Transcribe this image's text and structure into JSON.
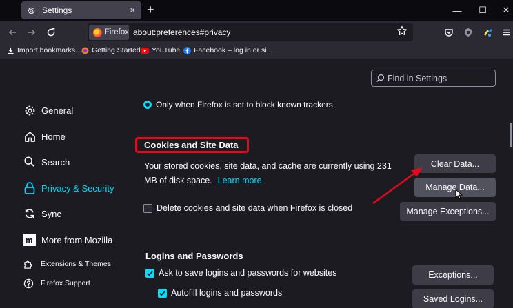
{
  "window": {
    "tab_title": "Settings",
    "tab_close": "×",
    "new_tab": "+",
    "minimize": "—",
    "maximize": "☐",
    "close": "✕"
  },
  "toolbar": {
    "identity_label": "Firefox",
    "url": "about:preferences#privacy"
  },
  "bookmarks": [
    {
      "label": "Import bookmarks...",
      "icon": "import-icon"
    },
    {
      "label": "Getting Started",
      "icon": "firefox-icon"
    },
    {
      "label": "YouTube",
      "icon": "youtube-icon"
    },
    {
      "label": "Facebook – log in or si...",
      "icon": "facebook-icon"
    }
  ],
  "search": {
    "placeholder": "Find in Settings"
  },
  "sidebar": {
    "items": [
      {
        "label": "General",
        "icon": "gear-icon"
      },
      {
        "label": "Home",
        "icon": "home-icon"
      },
      {
        "label": "Search",
        "icon": "search-icon"
      },
      {
        "label": "Privacy & Security",
        "icon": "lock-icon",
        "selected": true
      },
      {
        "label": "Sync",
        "icon": "sync-icon"
      },
      {
        "label": "More from Mozilla",
        "icon": "mozilla-icon"
      },
      {
        "label": "Extensions & Themes",
        "icon": "puzzle-icon"
      },
      {
        "label": "Firefox Support",
        "icon": "help-icon"
      }
    ]
  },
  "main": {
    "cut_option": "Only when Firefox is set to block known trackers",
    "cookies": {
      "title": "Cookies and Site Data",
      "description": "Your stored cookies, site data, and cache are currently using 231 MB of disk space.",
      "learn_more": "Learn more",
      "clear_button": "Clear Data...",
      "manage_button": "Manage Data...",
      "exceptions_button": "Manage Exceptions...",
      "delete_on_close": "Delete cookies and site data when Firefox is closed",
      "delete_on_close_checked": false
    },
    "logins": {
      "title": "Logins and Passwords",
      "ask_to_save": "Ask to save logins and passwords for websites",
      "ask_to_save_checked": true,
      "autofill": "Autofill logins and passwords",
      "autofill_checked": true,
      "exceptions_button": "Exceptions...",
      "saved_logins_button": "Saved Logins..."
    }
  },
  "colors": {
    "accent": "#00ddff",
    "highlight": "#e00b1c",
    "background": "#1c1b22"
  }
}
